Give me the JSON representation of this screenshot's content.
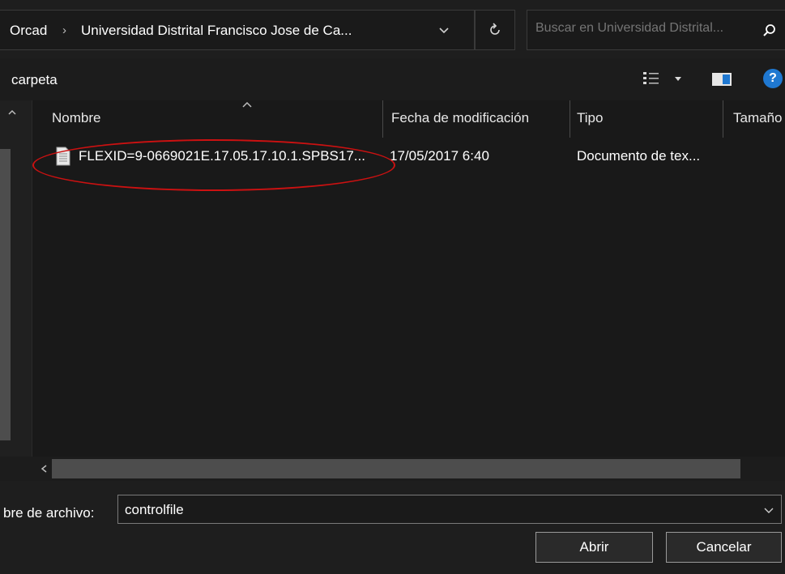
{
  "address_bar": {
    "crumbs": [
      "Orcad",
      "Universidad Distrital Francisco Jose de Ca..."
    ],
    "separator": "›"
  },
  "search": {
    "placeholder": "Buscar en Universidad Distrital..."
  },
  "toolbar": {
    "label": "carpeta",
    "help_label": "?"
  },
  "columns": [
    {
      "label": "Nombre"
    },
    {
      "label": "Fecha de modificación"
    },
    {
      "label": "Tipo"
    },
    {
      "label": "Tamaño"
    }
  ],
  "files": [
    {
      "name": "FLEXID=9-0669021E.17.05.17.10.1.SPBS17...",
      "date": "17/05/2017 6:40",
      "type": "Documento de tex..."
    }
  ],
  "footer": {
    "filename_label": "bre de archivo:",
    "filename_value": "controlfile",
    "open_label": "Abrir",
    "cancel_label": "Cancelar"
  },
  "colors": {
    "background": "#191919",
    "accent_help": "#1f78d1",
    "highlight_ellipse": "#cc1111"
  }
}
